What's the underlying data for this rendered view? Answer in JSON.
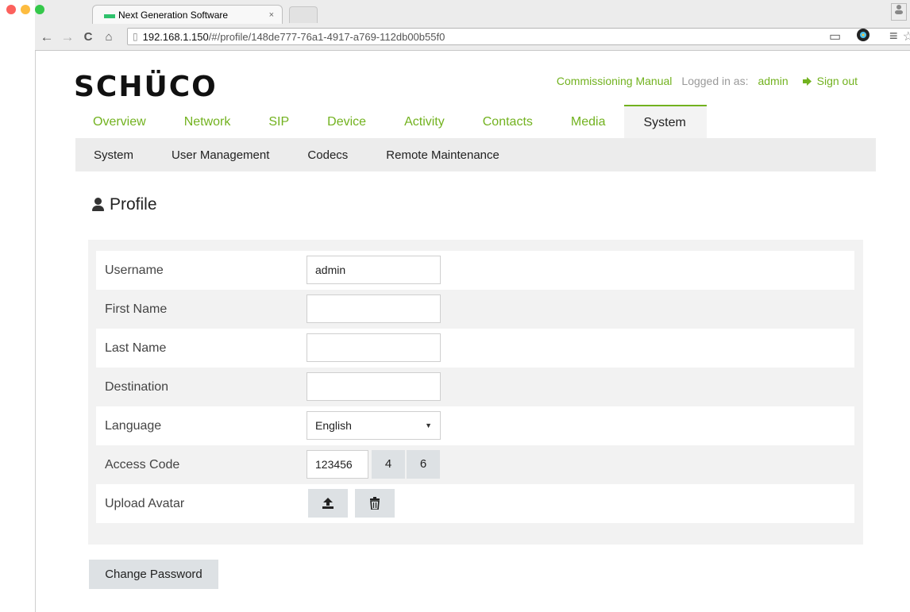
{
  "browser": {
    "tab_title": "Next Generation Software",
    "tab_close": "×",
    "url_host": "192.168.1.150",
    "url_path": "/#/profile/148de777-76a1-4917-a769-112db00b55f0"
  },
  "header": {
    "logo": "SCHÜCO",
    "manual_link": "Commissioning Manual",
    "logged_in_label": "Logged in as:",
    "user": "admin",
    "sign_out": "Sign out"
  },
  "nav": {
    "items": [
      "Overview",
      "Network",
      "SIP",
      "Device",
      "Activity",
      "Contacts",
      "Media",
      "System"
    ],
    "active": "System"
  },
  "subnav": {
    "items": [
      "System",
      "User Management",
      "Codecs",
      "Remote Maintenance"
    ]
  },
  "page": {
    "title": "Profile"
  },
  "form": {
    "username_label": "Username",
    "username_value": "admin",
    "first_name_label": "First Name",
    "first_name_value": "",
    "last_name_label": "Last Name",
    "last_name_value": "",
    "destination_label": "Destination",
    "destination_value": "",
    "language_label": "Language",
    "language_value": "English",
    "access_code_label": "Access Code",
    "access_code_value": "123456",
    "access_code_btn1": "4",
    "access_code_btn2": "6",
    "upload_avatar_label": "Upload Avatar",
    "change_password": "Change Password"
  },
  "icons": {
    "upload": "upload-icon",
    "delete": "trash-icon",
    "user": "user-icon",
    "sign_out": "sign-out-icon"
  },
  "colors": {
    "accent": "#72b21f",
    "button_bg": "#dde1e4",
    "panel_bg": "#f2f2f2"
  }
}
